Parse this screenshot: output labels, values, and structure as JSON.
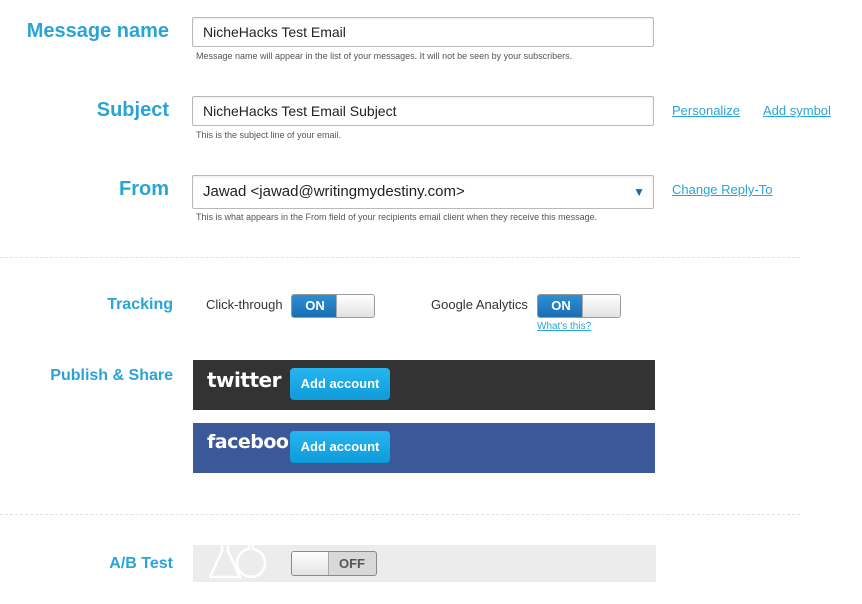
{
  "message_name": {
    "label": "Message name",
    "value": "NicheHacks Test Email",
    "hint": "Message name will appear in the list of your messages. It will not be seen by your subscribers."
  },
  "subject": {
    "label": "Subject",
    "value": "NicheHacks Test Email Subject",
    "hint": "This is the subject line of your email.",
    "personalize_link": "Personalize",
    "add_symbol_link": "Add symbol"
  },
  "from": {
    "label": "From",
    "value": "Jawad <jawad@writingmydestiny.com>",
    "hint": "This is what appears in the From field of your recipients email client when they receive this message.",
    "reply_to_link": "Change Reply-To"
  },
  "tracking": {
    "label": "Tracking",
    "click_through_label": "Click-through",
    "click_through_state": "ON",
    "analytics_label": "Google Analytics",
    "analytics_state": "ON",
    "whats_this_link": "What's this?"
  },
  "publish": {
    "label": "Publish & Share",
    "twitter_brand": "twitter",
    "twitter_button": "Add account",
    "facebook_brand": "facebook",
    "facebook_button": "Add account"
  },
  "ab_test": {
    "label": "A/B Test",
    "state": "OFF"
  },
  "colors": {
    "accent": "#2aa4d5",
    "twitter_bg": "#333333",
    "facebook_bg": "#3b5998",
    "button_blue": "#14a6e6"
  }
}
